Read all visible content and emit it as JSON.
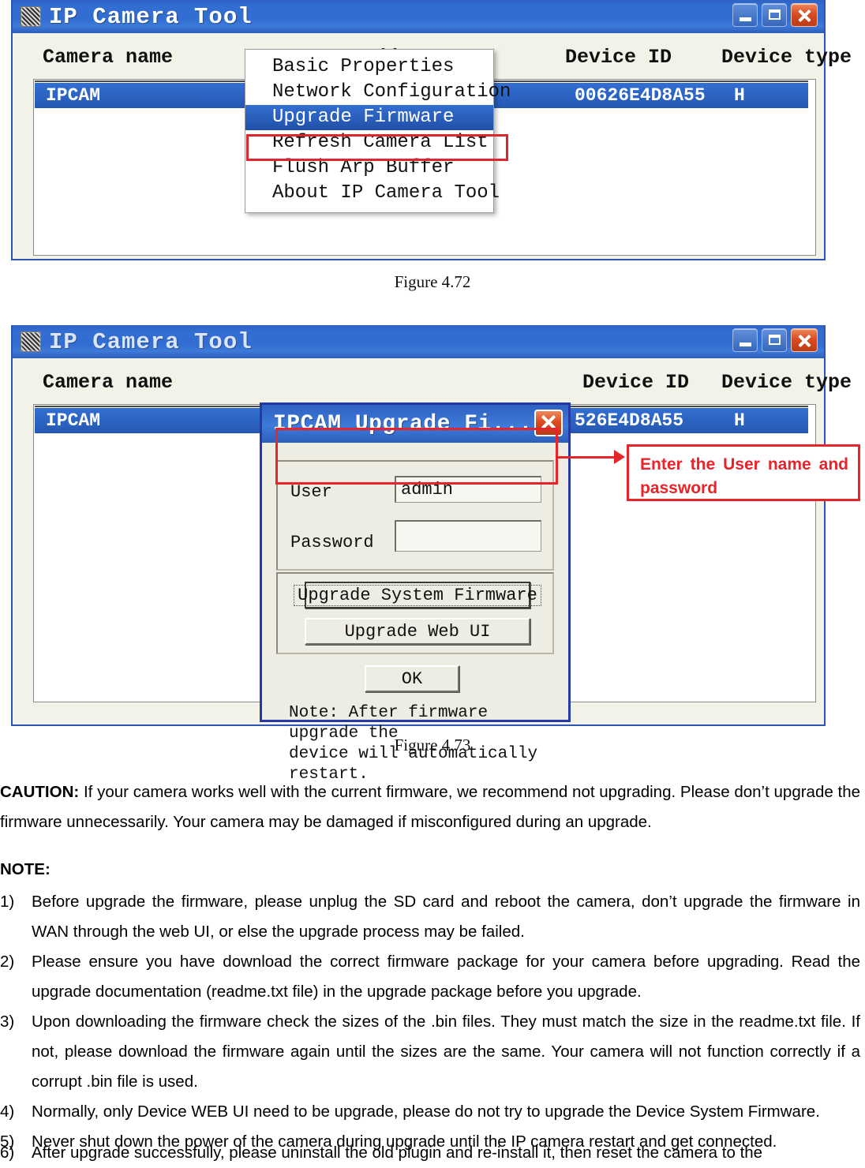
{
  "figure1": {
    "window_title": "IP Camera Tool",
    "titlebar_buttons": [
      "minimize-button",
      "maximize-button",
      "close-button"
    ],
    "columns": [
      "Camera name",
      "IP Address",
      "Device ID",
      "Device type"
    ],
    "row": {
      "camera_name": "IPCAM",
      "device_id": "00626E4D8A55",
      "device_type": "H"
    },
    "context_menu": {
      "items": [
        "Basic Properties",
        "Network Configuration",
        "Upgrade Firmware",
        "Refresh Camera List",
        "Flush Arp Buffer",
        "About IP Camera Tool"
      ],
      "selected": "Upgrade Firmware",
      "highlight_color": "#e8242a"
    },
    "caption": "Figure 4.72"
  },
  "figure2": {
    "window_title": "IP Camera Tool",
    "columns": [
      "Camera name",
      "Device ID",
      "Device type"
    ],
    "row": {
      "camera_name": "IPCAM",
      "device_id": "526E4D8A55",
      "device_type": "H"
    },
    "dialog": {
      "title": "IPCAM Upgrade Fi...",
      "user_label": "User",
      "user_value": "admin",
      "password_label": "Password",
      "password_value": "",
      "buttons": {
        "upgrade_system_firmware": "Upgrade System Firmware",
        "upgrade_web_ui": "Upgrade Web UI",
        "ok": "OK"
      },
      "note": "Note: After firmware upgrade the\ndevice will automatically restart."
    },
    "annotation": {
      "text": "Enter the User name and password",
      "color": "#e8242a"
    },
    "caption": "Figure 4.73"
  },
  "body": {
    "caution_label": "CAUTION:",
    "caution_text": " If your camera works well with the current firmware, we recommend not upgrading. Please don’t upgrade the firmware unnecessarily. Your camera may be damaged if misconfigured during an upgrade.",
    "note_label": "NOTE:",
    "notes": [
      {
        "marker": "1)",
        "text": "Before upgrade the firmware, please unplug the SD card and reboot the camera, don’t upgrade the firmware in WAN through the web UI, or else the upgrade process may be failed."
      },
      {
        "marker": "2)",
        "text": "Please ensure you have download the correct firmware package for your camera before upgrading. Read the upgrade documentation (readme.txt file) in the upgrade package before you upgrade."
      },
      {
        "marker": "3)",
        "text": "Upon downloading the firmware check the sizes of the .bin files. They must match the size in the readme.txt file. If not, please download the firmware again until the sizes are the same. Your camera will not function correctly if a corrupt .bin file is used."
      },
      {
        "marker": "4)",
        "text": "Normally, only Device WEB UI need to be upgrade, please do not try to upgrade the Device System Firmware."
      },
      {
        "marker": "5)",
        "text": " Never shut down the power of the camera during upgrade until the IP camera restart and get connected."
      },
      {
        "marker": "6)",
        "text": " After upgrade successfully, please uninstall the old plugin and re-install it, then reset the camera to the"
      }
    ]
  }
}
